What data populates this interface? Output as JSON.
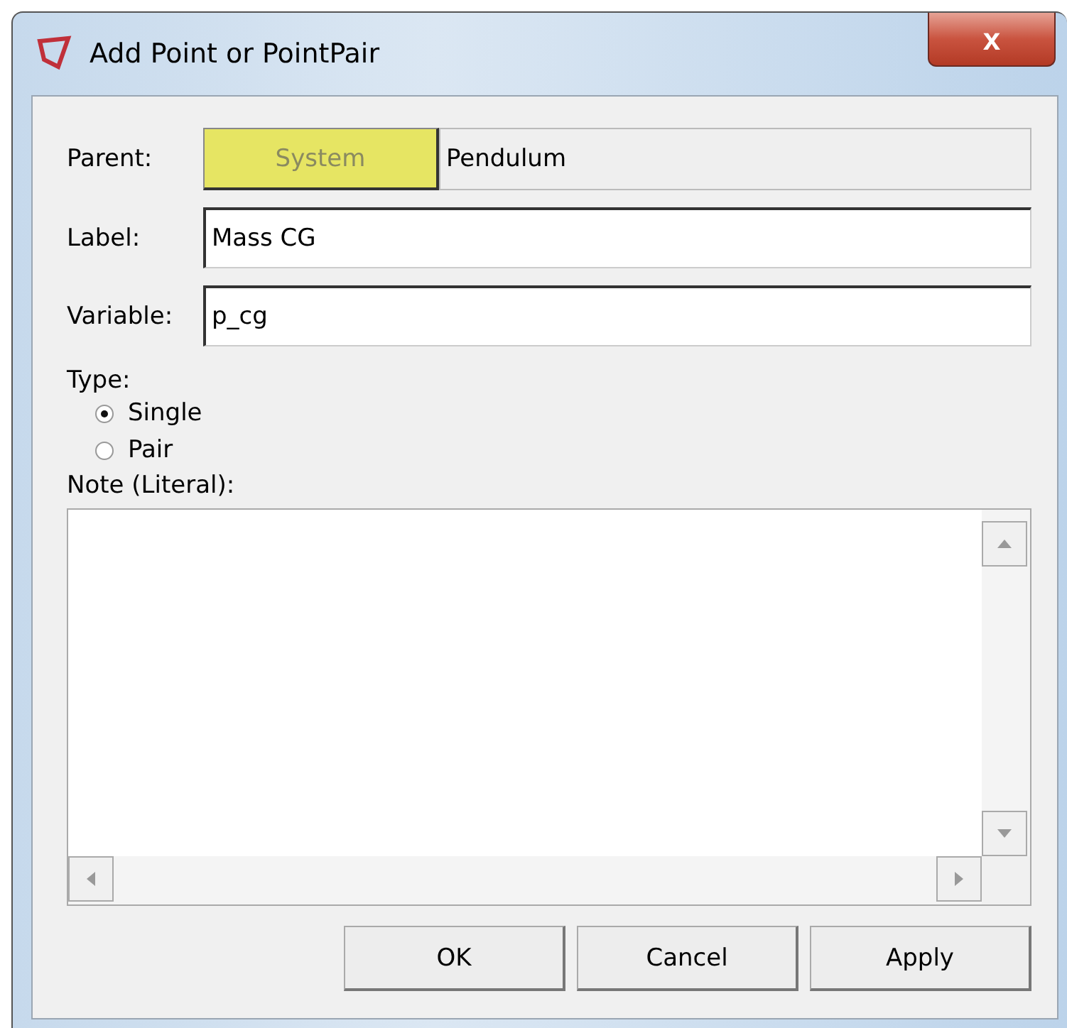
{
  "window": {
    "title": "Add Point or PointPair",
    "close": "x"
  },
  "parent": {
    "label": "Parent:",
    "button": "System",
    "value": "Pendulum"
  },
  "fields": [
    {
      "label": "Label:",
      "value": "Mass CG"
    },
    {
      "label": "Variable:",
      "value": "p_cg"
    }
  ],
  "type": {
    "label": "Type:",
    "options": [
      {
        "label": "Single",
        "selected": true
      },
      {
        "label": "Pair",
        "selected": false
      }
    ]
  },
  "note": {
    "label": "Note (Literal):"
  },
  "buttons": [
    "OK",
    "Cancel",
    "Apply"
  ]
}
